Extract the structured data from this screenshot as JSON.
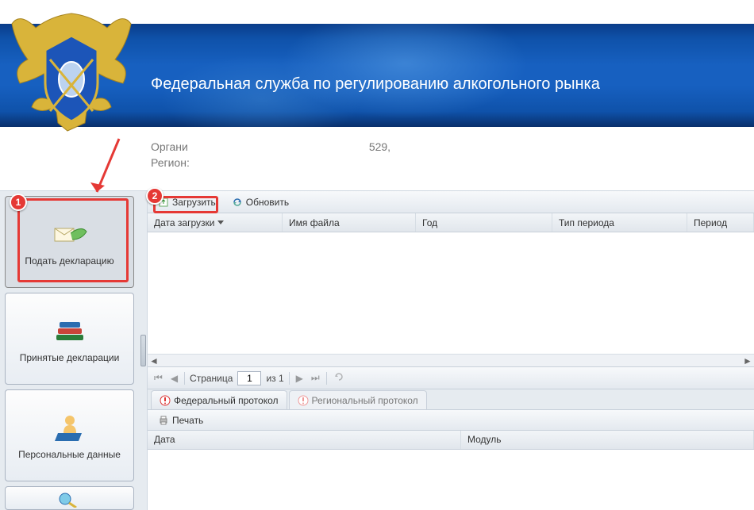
{
  "header": {
    "title": "Федеральная служба по регулированию алкогольного рынка"
  },
  "org": {
    "org_label": "Органи",
    "org_tail": "529,",
    "region_label": "Регион:"
  },
  "sidebar": {
    "items": [
      {
        "label": "Подать декларацию"
      },
      {
        "label": "Принятые декларации"
      },
      {
        "label": "Персональные данные"
      }
    ]
  },
  "toolbar": {
    "load_label": "Загрузить",
    "refresh_label": "Обновить"
  },
  "grid": {
    "columns": {
      "load_date": "Дата загрузки",
      "file_name": "Имя файла",
      "year": "Год",
      "period_type": "Тип периода",
      "period": "Период"
    }
  },
  "pager": {
    "page_label": "Страница",
    "page_value": "1",
    "of_label": "из 1"
  },
  "protocol_tabs": {
    "federal": "Федеральный протокол",
    "regional": "Региональный протокол"
  },
  "sub_toolbar": {
    "print_label": "Печать"
  },
  "grid2": {
    "columns": {
      "date": "Дата",
      "module": "Модуль"
    }
  },
  "callouts": {
    "one": "1",
    "two": "2"
  }
}
